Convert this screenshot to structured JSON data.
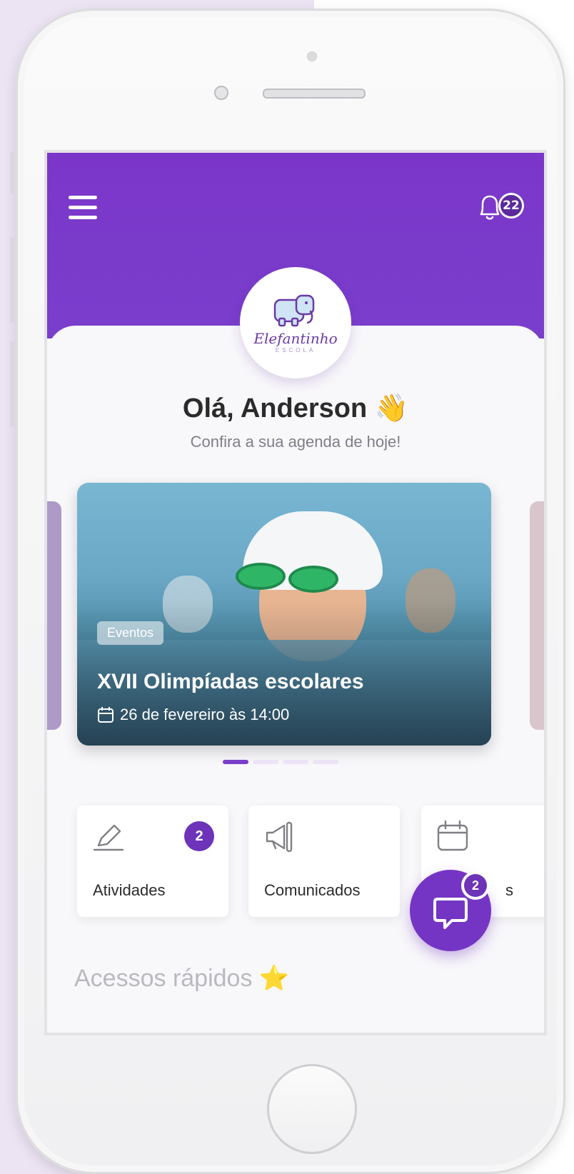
{
  "header": {
    "notifications_count": "22",
    "brand_name": "Elefantinho",
    "brand_sub": "ESCOLA"
  },
  "greeting": {
    "title": "Olá, Anderson 👋",
    "subtitle": "Confira a sua agenda de hoje!"
  },
  "carousel": {
    "active_index": 0,
    "total": 4,
    "event": {
      "tag": "Eventos",
      "title": "XVII Olimpíadas escolares",
      "date": "26 de fevereiro às 14:00"
    }
  },
  "shortcuts": [
    {
      "label": "Atividades",
      "badge": "2",
      "icon": "pencil-icon"
    },
    {
      "label": "Comunicados",
      "icon": "megaphone-icon"
    },
    {
      "label": "Eventos",
      "icon": "calendar-icon",
      "visible_text": "s"
    }
  ],
  "chat": {
    "badge": "2",
    "icon": "chat-icon"
  },
  "section": {
    "quick_access": "Acessos rápidos ⭐"
  },
  "colors": {
    "primary": "#7a3ec8",
    "background": "#f8f7fa",
    "frame_bg": "#ece3f3"
  }
}
